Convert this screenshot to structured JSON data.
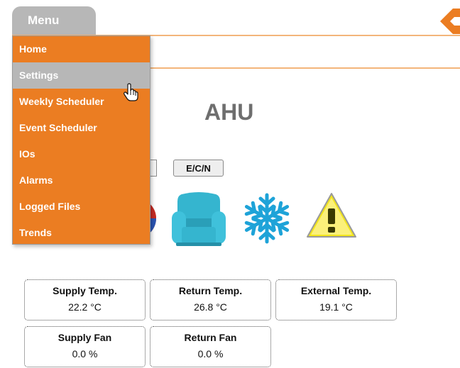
{
  "header": {
    "menu_label": "Menu"
  },
  "menu": {
    "items": [
      {
        "label": "Home"
      },
      {
        "label": "Settings"
      },
      {
        "label": "Weekly Scheduler"
      },
      {
        "label": "Event Scheduler"
      },
      {
        "label": "IOs"
      },
      {
        "label": "Alarms"
      },
      {
        "label": "Logged Files"
      },
      {
        "label": "Trends"
      }
    ],
    "hovered": "Settings"
  },
  "main": {
    "title": "AHU",
    "mode_button_label": "E/C/N"
  },
  "status_icons": [
    "heating-cooling-icon",
    "armchair-icon",
    "snowflake-icon",
    "warning-icon"
  ],
  "readings": [
    {
      "label": "Supply Temp.",
      "value": "22.2 °C"
    },
    {
      "label": "Return Temp.",
      "value": "26.8 °C"
    },
    {
      "label": "External Temp.",
      "value": "19.1 °C"
    },
    {
      "label": "Supply Fan",
      "value": "0.0 %"
    },
    {
      "label": "Return Fan",
      "value": "0.0 %"
    }
  ],
  "colors": {
    "menu_orange": "#eb7d22",
    "menu_gray": "#b7b7b7",
    "title_gray": "#6e6e6e",
    "armchair_teal": "#35b5cf",
    "snowflake_blue": "#1ea3d8",
    "warning_yellow": "#f2e51a"
  }
}
